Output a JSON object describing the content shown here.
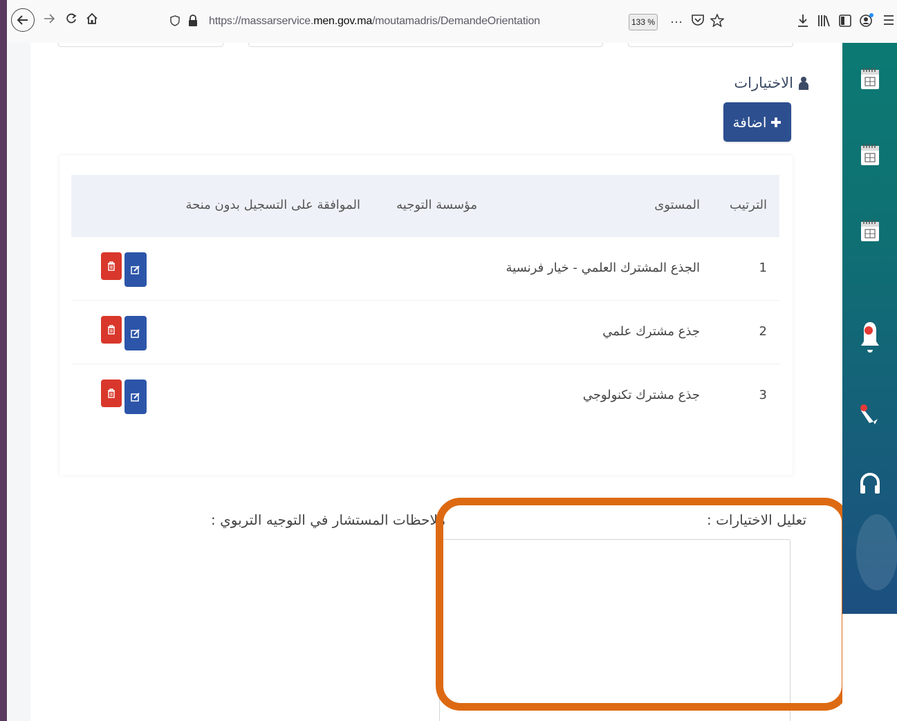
{
  "browser": {
    "url_prefix": "https://massarservice.",
    "url_domain": "men.gov.ma",
    "url_path": "/moutamadris/DemandeOrientation",
    "zoom": "133 %",
    "more_label": "···"
  },
  "section": {
    "title": "الاختيارات",
    "add_label": "اضافة"
  },
  "table": {
    "headers": {
      "rank": "الترتيب",
      "level": "المستوى",
      "institution": "مؤسسة التوجيه",
      "approval": "الموافقة على التسجيل بدون منحة"
    },
    "rows": [
      {
        "rank": "1",
        "level": "الجذع المشترك العلمي - خيار فرنسية",
        "institution": "",
        "approval": ""
      },
      {
        "rank": "2",
        "level": "جذع مشترك علمي",
        "institution": "",
        "approval": ""
      },
      {
        "rank": "3",
        "level": "جذع مشترك تكنولوجي",
        "institution": "",
        "approval": ""
      }
    ]
  },
  "form": {
    "justification_label": "تعليل الاختيارات :",
    "counselor_label": "ملاحظات المستشار في التوجيه التربوي :"
  },
  "colors": {
    "primary": "#2d4f8f",
    "danger": "#d9372b",
    "edit": "#2c55a9",
    "sidebar": "#0c7a73",
    "highlight": "#dd6a12"
  },
  "icons": {
    "sidebar": [
      "calendar-icon",
      "calendar-icon",
      "calendar-icon",
      "bell-icon",
      "megaphone-icon",
      "headset-icon"
    ],
    "row_actions": [
      "edit-icon",
      "trash-icon"
    ]
  }
}
